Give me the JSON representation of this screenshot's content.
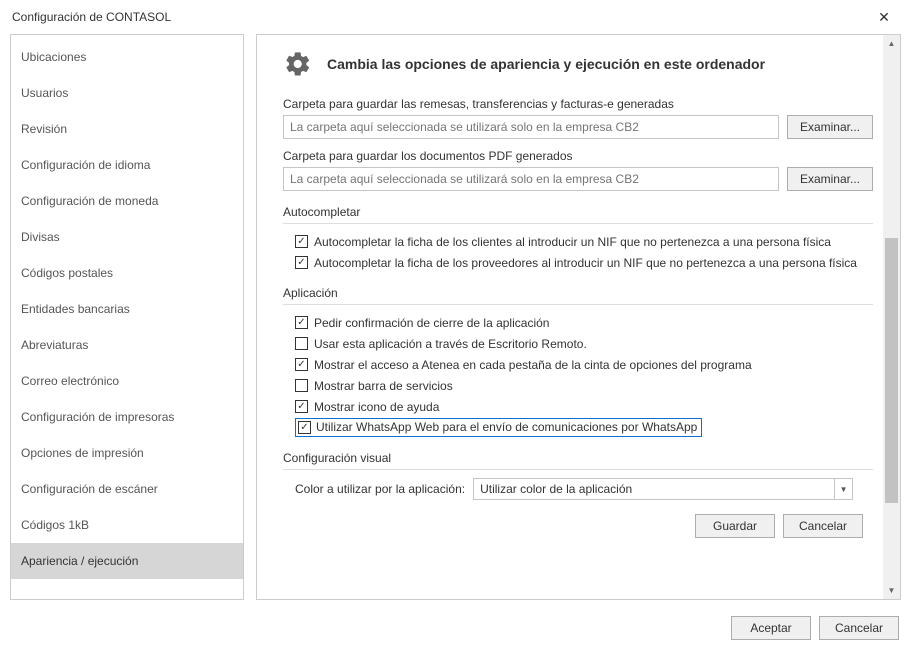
{
  "window": {
    "title": "Configuración de CONTASOL"
  },
  "sidebar": {
    "items": [
      {
        "label": "Ubicaciones"
      },
      {
        "label": "Usuarios"
      },
      {
        "label": "Revisión"
      },
      {
        "label": "Configuración de idioma"
      },
      {
        "label": "Configuración de moneda"
      },
      {
        "label": "Divisas"
      },
      {
        "label": "Códigos postales"
      },
      {
        "label": "Entidades bancarias"
      },
      {
        "label": "Abreviaturas"
      },
      {
        "label": "Correo electrónico"
      },
      {
        "label": "Configuración de impresoras"
      },
      {
        "label": "Opciones de impresión"
      },
      {
        "label": "Configuración de escáner"
      },
      {
        "label": "Códigos 1kB"
      },
      {
        "label": "Apariencia / ejecución"
      }
    ],
    "selected_index": 14
  },
  "header": {
    "title": "Cambia las opciones de apariencia y ejecución en este ordenador"
  },
  "folders": {
    "label1": "Carpeta para guardar las remesas, transferencias y facturas-e generadas",
    "placeholder1": "La carpeta aquí seleccionada se utilizará solo en la empresa CB2",
    "browse1": "Examinar...",
    "label2": "Carpeta para guardar los documentos PDF generados",
    "placeholder2": "La carpeta aquí seleccionada se utilizará solo en la empresa CB2",
    "browse2": "Examinar..."
  },
  "sections": {
    "autocomplete": "Autocompletar",
    "application": "Aplicación",
    "visual": "Configuración visual"
  },
  "autocomplete": {
    "c1": "Autocompletar la ficha de los clientes al introducir un NIF que no pertenezca a una persona física",
    "c2": "Autocompletar la ficha de los proveedores al introducir un NIF que no pertenezca a una persona física"
  },
  "application": {
    "c1": "Pedir confirmación de cierre de la aplicación",
    "c2": "Usar esta aplicación a través de Escritorio Remoto.",
    "c3": "Mostrar el acceso a Atenea en cada pestaña de la cinta de opciones del programa",
    "c4": "Mostrar barra de servicios",
    "c5": "Mostrar icono de ayuda",
    "c6": "Utilizar WhatsApp Web para el envío de comunicaciones por WhatsApp"
  },
  "visual": {
    "label": "Color a utilizar por la aplicación:",
    "selected": "Utilizar color de la aplicación"
  },
  "pane_buttons": {
    "save": "Guardar",
    "cancel": "Cancelar"
  },
  "footer": {
    "accept": "Aceptar",
    "cancel": "Cancelar"
  }
}
